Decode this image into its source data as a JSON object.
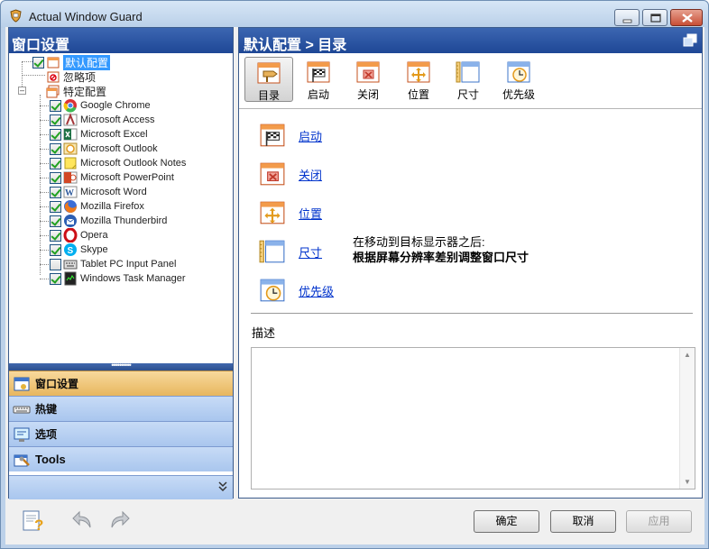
{
  "window": {
    "title": "Actual Window Guard"
  },
  "left_panel": {
    "header": "窗口设置",
    "tree": {
      "default_config": "默认配置",
      "ignore": "忽略项",
      "specific_config": "特定配置",
      "apps": [
        {
          "label": "Google Chrome",
          "checked": true,
          "icon": "chrome-icon"
        },
        {
          "label": "Microsoft Access",
          "checked": true,
          "icon": "access-icon"
        },
        {
          "label": "Microsoft Excel",
          "checked": true,
          "icon": "excel-icon"
        },
        {
          "label": "Microsoft Outlook",
          "checked": true,
          "icon": "outlook-icon"
        },
        {
          "label": "Microsoft Outlook Notes",
          "checked": true,
          "icon": "notes-icon"
        },
        {
          "label": "Microsoft PowerPoint",
          "checked": true,
          "icon": "powerpoint-icon"
        },
        {
          "label": "Microsoft Word",
          "checked": true,
          "icon": "word-icon"
        },
        {
          "label": "Mozilla Firefox",
          "checked": true,
          "icon": "firefox-icon"
        },
        {
          "label": "Mozilla Thunderbird",
          "checked": true,
          "icon": "thunderbird-icon"
        },
        {
          "label": "Opera",
          "checked": true,
          "icon": "opera-icon"
        },
        {
          "label": "Skype",
          "checked": true,
          "icon": "skype-icon"
        },
        {
          "label": "Tablet PC Input Panel",
          "checked": false,
          "icon": "keyboard-icon"
        },
        {
          "label": "Windows Task Manager",
          "checked": true,
          "icon": "task-manager-icon"
        }
      ]
    },
    "nav": {
      "window_settings": "窗口设置",
      "hotkeys": "热键",
      "options": "选项",
      "tools": "Tools"
    }
  },
  "right_panel": {
    "header": "默认配置 > 目录",
    "toolbar": [
      "目录",
      "启动",
      "关闭",
      "位置",
      "尺寸",
      "优先级"
    ],
    "links": {
      "startup": "启动",
      "close": "关闭",
      "position": "位置",
      "size": "尺寸",
      "priority": "优先级"
    },
    "size_info_line1": "在移动到目标显示器之后:",
    "size_info_line2": "根据屏幕分辨率差别调整窗口尺寸",
    "description_label": "描述",
    "description_text": ""
  },
  "buttons": {
    "ok": "确定",
    "cancel": "取消",
    "apply": "应用"
  },
  "colors": {
    "header_blue": "#1e4796",
    "active_nav": "#e7b65e",
    "link": "#0033cc"
  }
}
